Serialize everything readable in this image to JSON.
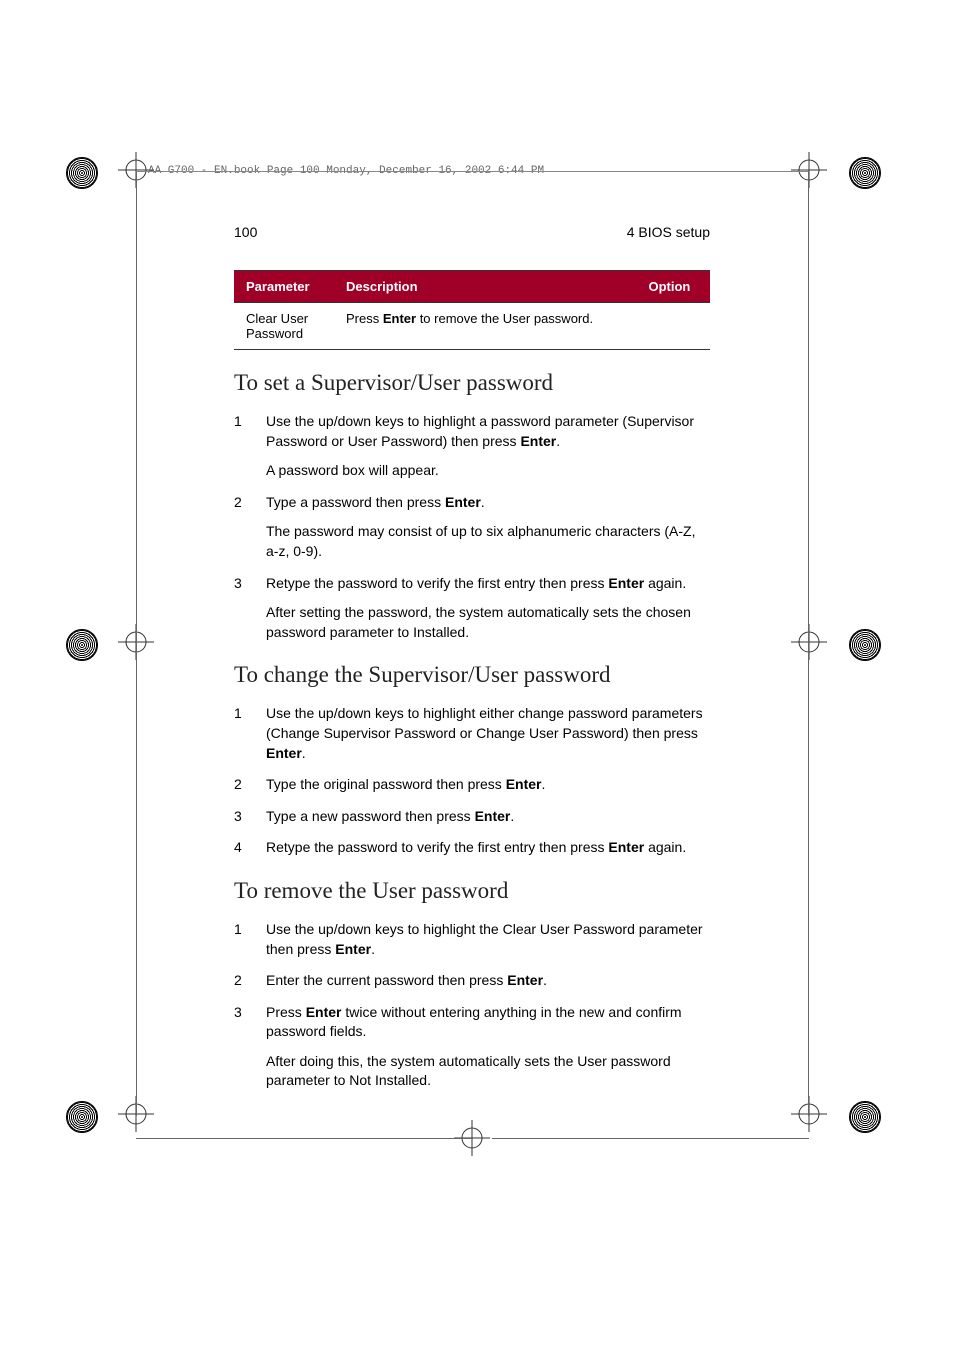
{
  "book_header": "AA G700 - EN.book  Page 100  Monday, December 16, 2002  6:44 PM",
  "page_number": "100",
  "chapter_header": "4 BIOS setup",
  "table": {
    "headers": {
      "param": "Parameter",
      "desc": "Description",
      "opt": "Option"
    },
    "row": {
      "param": "Clear User Password",
      "desc_before": "Press ",
      "desc_bold": "Enter",
      "desc_after": " to remove the User password.",
      "opt": ""
    }
  },
  "sections": {
    "set": {
      "title": "To set a Supervisor/User password",
      "items": [
        {
          "p1a": "Use the up/down keys to highlight a password parameter (Supervisor Password or User Password) then press ",
          "p1b": "Enter",
          "p1c": ".",
          "sub": "A password box will appear."
        },
        {
          "p1a": "Type a password then press ",
          "p1b": "Enter",
          "p1c": ".",
          "sub": "The password may consist of up to six alphanumeric characters (A-Z, a-z, 0-9)."
        },
        {
          "p1a": "Retype the password to verify the first entry then press ",
          "p1b": "Enter",
          "p1c": " again.",
          "sub": "After setting the password, the system automatically sets the chosen password parameter to Installed."
        }
      ]
    },
    "change": {
      "title": "To change the Supervisor/User password",
      "items": [
        {
          "p1a": "Use the up/down keys to highlight either change password parameters (Change Supervisor Password or Change User Password) then press ",
          "p1b": "Enter",
          "p1c": "."
        },
        {
          "p1a": "Type the original password then press ",
          "p1b": "Enter",
          "p1c": "."
        },
        {
          "p1a": "Type a new password then press ",
          "p1b": "Enter",
          "p1c": "."
        },
        {
          "p1a": "Retype the password to verify the first entry then press ",
          "p1b": "Enter",
          "p1c": " again."
        }
      ]
    },
    "remove": {
      "title": "To remove the User password",
      "items": [
        {
          "p1a": "Use the up/down keys to highlight the Clear User Password parameter then press ",
          "p1b": "Enter",
          "p1c": "."
        },
        {
          "p1a": "Enter the current password then press ",
          "p1b": "Enter",
          "p1c": "."
        },
        {
          "p1a": "Press ",
          "p1b": "Enter",
          "p1c": " twice without entering anything in the new and confirm password fields.",
          "sub": "After doing this, the system automatically sets the User password parameter to Not Installed."
        }
      ]
    }
  }
}
